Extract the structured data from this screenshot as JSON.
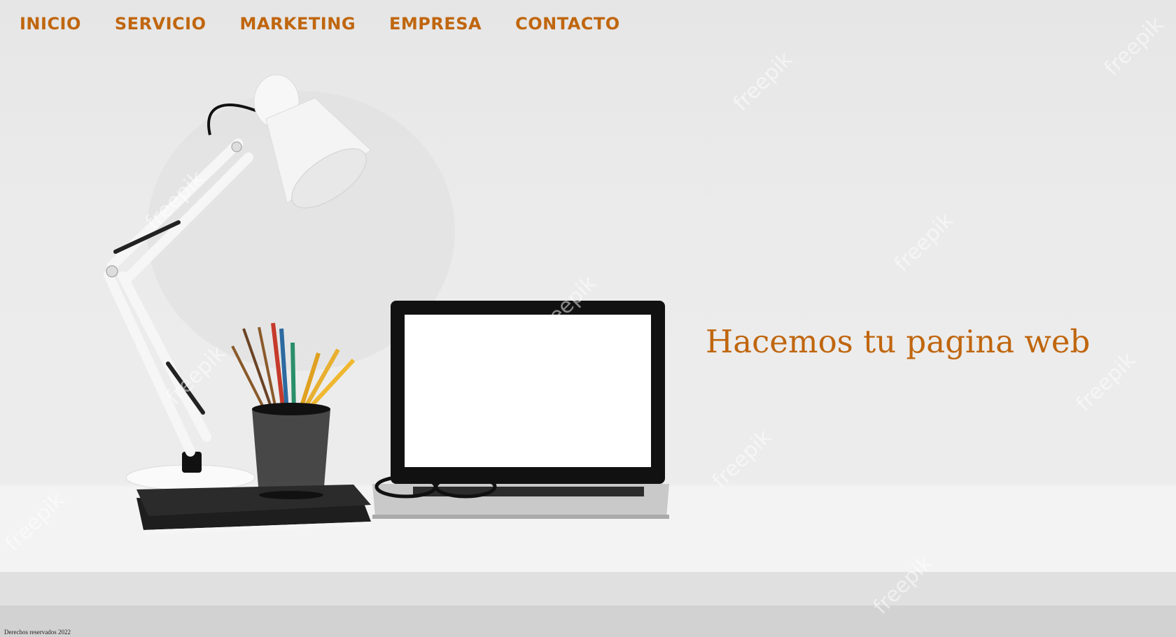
{
  "nav": {
    "items": [
      {
        "label": "INICIO"
      },
      {
        "label": "SERVICIO"
      },
      {
        "label": "MARKETING"
      },
      {
        "label": "EMPRESA"
      },
      {
        "label": "CONTACTO"
      }
    ]
  },
  "hero": {
    "heading": "Hacemos tu pagina web"
  },
  "footer": {
    "copyright": "Derechos reservados 2022"
  },
  "watermark": {
    "text": "freepik"
  },
  "colors": {
    "accent": "#c0660e",
    "background": "#ebebeb"
  }
}
